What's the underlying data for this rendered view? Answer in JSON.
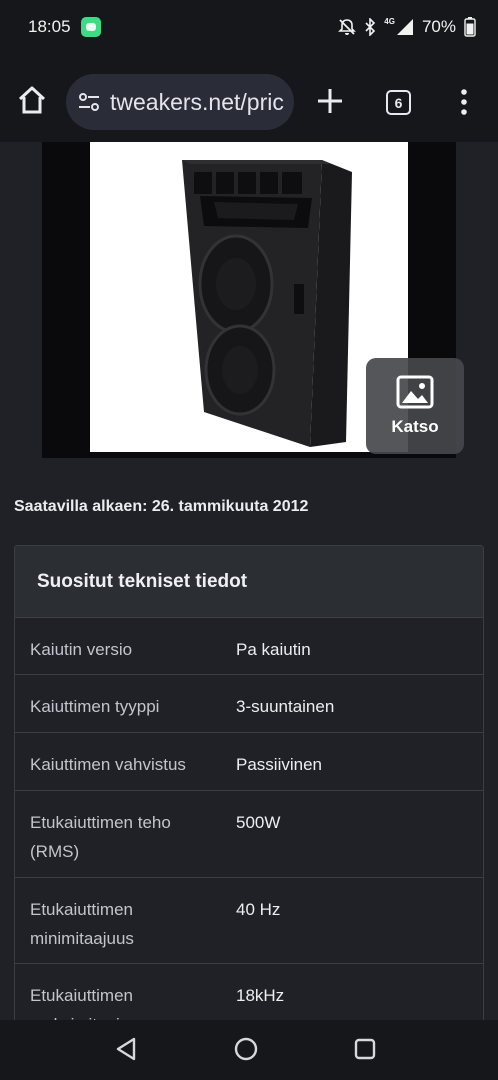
{
  "status_bar": {
    "time": "18:05",
    "battery_percent": "70%",
    "network_label": "4G",
    "icons": [
      "notification-app-icon",
      "do-not-disturb-icon",
      "bluetooth-icon",
      "signal-icon",
      "battery-icon"
    ]
  },
  "browser": {
    "url": "tweakers.net/pric",
    "tab_count": "6",
    "icons": [
      "home-icon",
      "site-settings-icon",
      "new-tab-icon",
      "tabs-icon",
      "menu-icon"
    ]
  },
  "product": {
    "view_button_label": "Katso",
    "availability": "Saatavilla alkaen: 26. tammikuuta 2012"
  },
  "specs": {
    "title": "Suositut tekniset tiedot",
    "rows": [
      {
        "key": "Kaiutin versio",
        "value": "Pa kaiutin"
      },
      {
        "key": "Kaiuttimen tyyppi",
        "value": "3-suuntainen"
      },
      {
        "key": "Kaiuttimen vahvistus",
        "value": "Passiivinen"
      },
      {
        "key": "Etukaiuttimen teho (RMS)",
        "value": "500W"
      },
      {
        "key": "Etukaiuttimen minimitaajuus",
        "value": "40 Hz"
      },
      {
        "key": "Etukaiuttimen maksimitaajuus",
        "value": "18kHz"
      }
    ]
  },
  "nav": {
    "icons": [
      "back-icon",
      "home-circle-icon",
      "recents-icon"
    ]
  }
}
